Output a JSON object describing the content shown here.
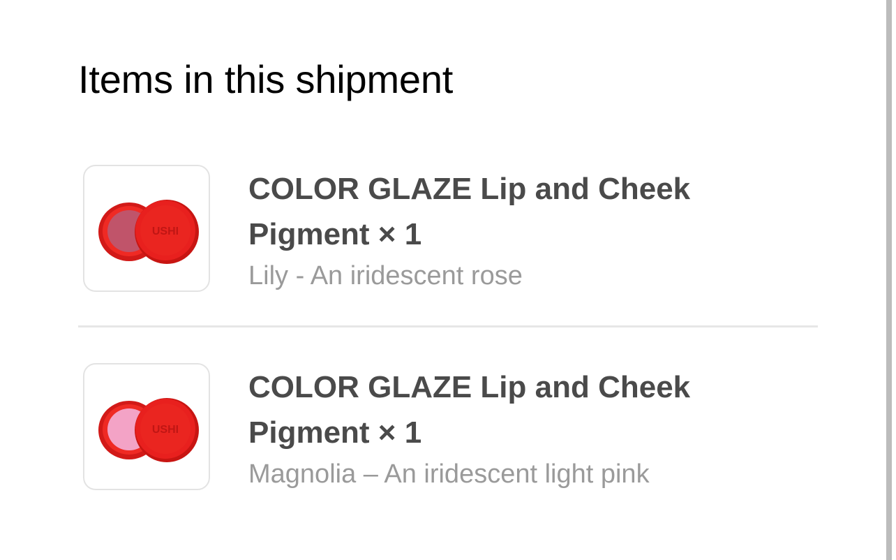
{
  "section": {
    "title": "Items in this shipment"
  },
  "items": [
    {
      "title_line1": "COLOR GLAZE Lip and Cheek",
      "title_line2": "Pigment × 1",
      "variant": "Lily - An iridescent rose",
      "pigment_color": "#c0546a",
      "case_color": "#e8201e",
      "thumbnail_icon": "lip-cheek-pigment-compact-icon"
    },
    {
      "title_line1": "COLOR GLAZE Lip and Cheek",
      "title_line2": "Pigment × 1",
      "variant": "Magnolia – An iridescent light pink",
      "pigment_color": "#f3a3c6",
      "case_color": "#e8201e",
      "thumbnail_icon": "lip-cheek-pigment-compact-icon"
    }
  ],
  "colors": {
    "title_text": "#000000",
    "item_title_text": "#4a4a4a",
    "variant_text": "#9a9a9a",
    "divider": "#e6e6e6",
    "thumb_border": "#e3e3e3"
  }
}
